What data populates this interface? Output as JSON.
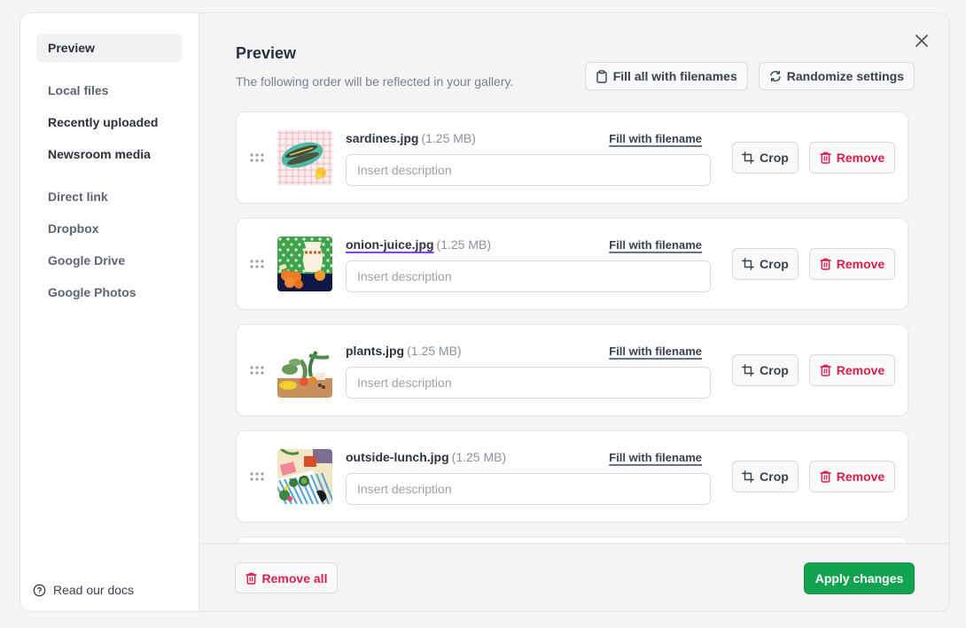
{
  "sidebar": {
    "items": [
      {
        "label": "Preview",
        "state": "active"
      },
      {
        "label": "Local files",
        "state": "muted"
      },
      {
        "label": "Recently uploaded",
        "state": "strong"
      },
      {
        "label": "Newsroom media",
        "state": "strong"
      },
      {
        "label": "Direct link",
        "state": "muted"
      },
      {
        "label": "Dropbox",
        "state": "muted"
      },
      {
        "label": "Google Drive",
        "state": "muted"
      },
      {
        "label": "Google Photos",
        "state": "muted"
      }
    ],
    "docs_label": "Read our docs",
    "docs_icon": "question-circle-icon"
  },
  "header": {
    "title": "Preview",
    "subtitle": "The following order will be reflected in your gallery.",
    "close_icon": "close-icon",
    "fill_all_label": "Fill all with filenames",
    "fill_all_icon": "clipboard-icon",
    "randomize_label": "Randomize settings",
    "randomize_icon": "refresh-icon"
  },
  "files": [
    {
      "name": "sardines.jpg",
      "size": "(1.25 MB)",
      "placeholder": "Insert description",
      "value": "",
      "fill_label": "Fill with filename",
      "crop_label": "Crop",
      "remove_label": "Remove",
      "focused": false
    },
    {
      "name": "onion-juice.jpg",
      "size": "(1.25 MB)",
      "placeholder": "Insert description",
      "value": "",
      "fill_label": "Fill with filename",
      "crop_label": "Crop",
      "remove_label": "Remove",
      "focused": true
    },
    {
      "name": "plants.jpg",
      "size": "(1.25 MB)",
      "placeholder": "Insert description",
      "value": "",
      "fill_label": "Fill with filename",
      "crop_label": "Crop",
      "remove_label": "Remove",
      "focused": false
    },
    {
      "name": "outside-lunch.jpg",
      "size": "(1.25 MB)",
      "placeholder": "Insert description",
      "value": "",
      "fill_label": "Fill with filename",
      "crop_label": "Crop",
      "remove_label": "Remove",
      "focused": false
    }
  ],
  "footer": {
    "remove_all_label": "Remove all",
    "apply_label": "Apply changes"
  },
  "colors": {
    "danger": "#e11d48",
    "primary": "#13a350",
    "focus_underline": "#8b3dff"
  }
}
